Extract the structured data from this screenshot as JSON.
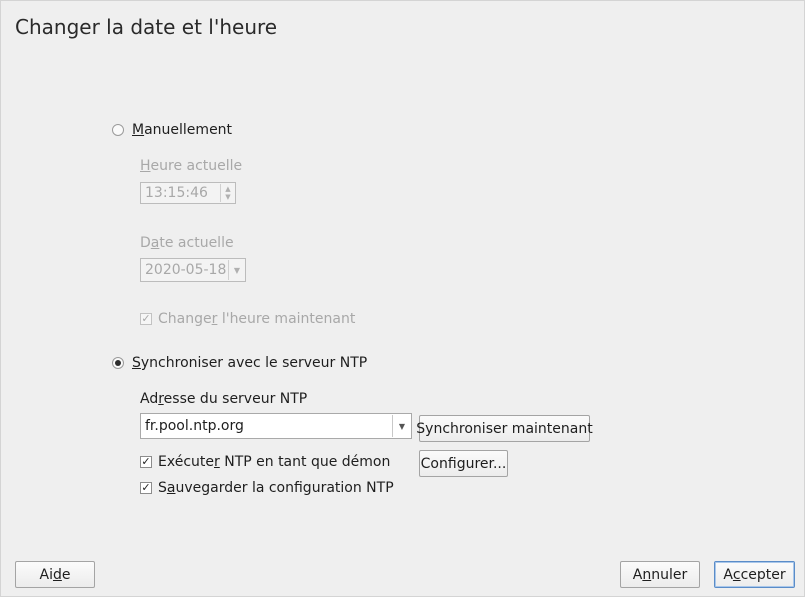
{
  "window": {
    "title": "Changer la date et l'heure"
  },
  "manual": {
    "radio_label_u": "M",
    "radio_label_rest": "anuellement",
    "selected": false,
    "current_time": {
      "label_u": "H",
      "label_rest": "eure actuelle",
      "value": "13:15:46"
    },
    "current_date": {
      "label_pre": "D",
      "label_u": "a",
      "label_rest": "te actuelle",
      "value": "2020-05-18"
    },
    "change_now": {
      "label_pre": "Change",
      "label_u": "r",
      "label_rest": " l'heure maintenant",
      "checked": true,
      "enabled": false
    }
  },
  "ntp": {
    "radio_label_u": "S",
    "radio_label_rest": "ynchroniser avec le serveur NTP",
    "selected": true,
    "server_label_pre": "Ad",
    "server_label_u": "r",
    "server_label_rest": "esse du serveur NTP",
    "server_value": "fr.pool.ntp.org",
    "sync_now_button": "Synchroniser maintenant",
    "configure_button": "Configurer...",
    "run_as_daemon": {
      "label_pre": "Exécute",
      "label_u": "r",
      "label_rest": " NTP en tant que démon",
      "checked": true
    },
    "save_config": {
      "label_pre": "S",
      "label_u": "a",
      "label_rest": "uvegarder la configuration NTP",
      "checked": true
    }
  },
  "footer": {
    "help_pre": "Ai",
    "help_u": "d",
    "help_rest": "e",
    "cancel_pre": "A",
    "cancel_u": "n",
    "cancel_rest": "nuler",
    "accept_pre": "A",
    "accept_u": "c",
    "accept_rest": "cepter"
  },
  "icons": {
    "check_glyph": "✓",
    "spin_up": "▲",
    "spin_down": "▼",
    "combo_arrow": "▼"
  }
}
